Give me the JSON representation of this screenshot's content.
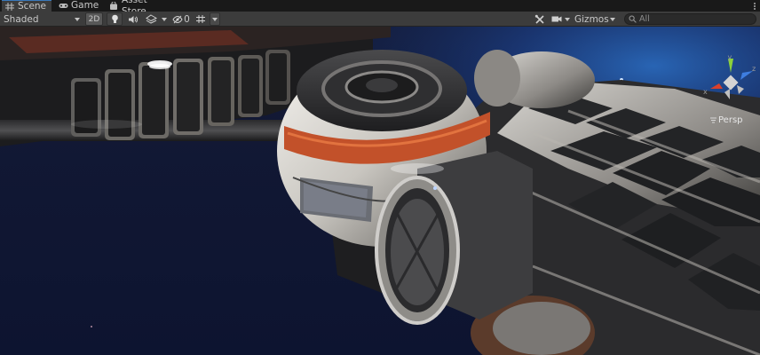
{
  "tabs": [
    {
      "label": "Scene",
      "icon": "hash-icon",
      "active": true
    },
    {
      "label": "Game",
      "icon": "gamepad-icon",
      "active": false
    },
    {
      "label": "Asset Store",
      "icon": "shopping-bag-icon",
      "active": false
    }
  ],
  "toolbar": {
    "draw_mode": "Shaded",
    "mode_2d": "2D",
    "hidden_count": "0",
    "gizmos_label": "Gizmos",
    "search_placeholder": "All"
  },
  "view": {
    "projection_label": "Persp",
    "axis_x": "x",
    "axis_y": "y",
    "axis_z": "z"
  },
  "colors": {
    "accent_tab": "#3a79bb",
    "axis_x": "#d8402c",
    "axis_y": "#8cd23a",
    "axis_z": "#3e7ee0",
    "space": "#101830",
    "hull_orange": "#c2512a"
  }
}
